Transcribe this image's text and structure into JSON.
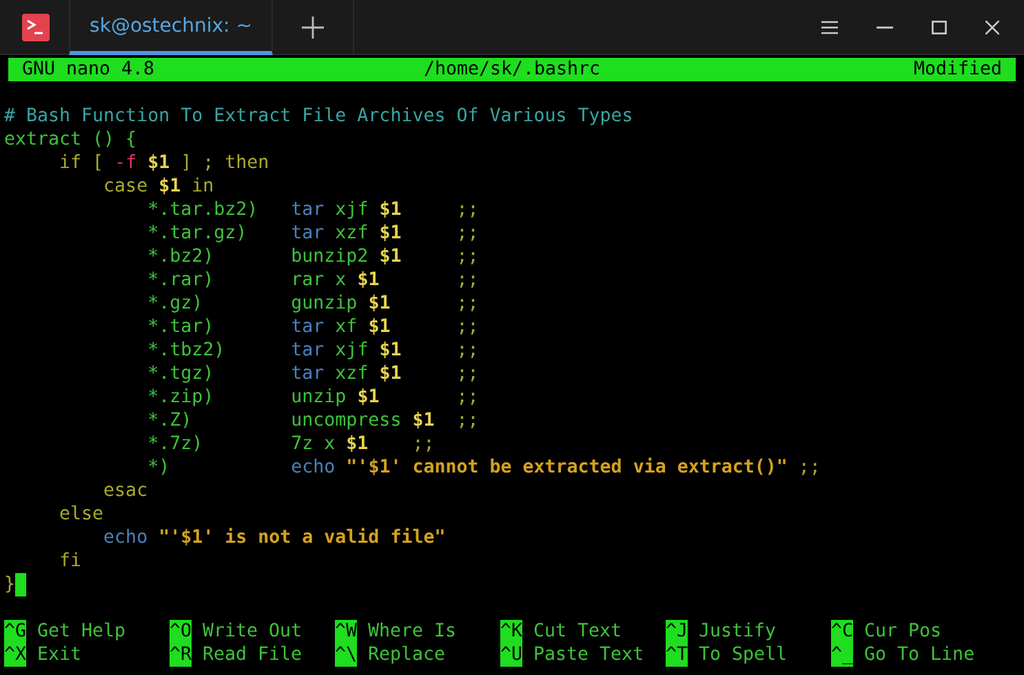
{
  "tabs": [
    {
      "label": "sk@ostechnix: ~",
      "selected": true
    }
  ],
  "header": {
    "app": "GNU nano 4.8",
    "file": "/home/sk/.bashrc",
    "status": "Modified"
  },
  "lines": [
    [
      {
        "kind": "comment",
        "text": "# Bash Function To Extract File Archives Of Various Types"
      }
    ],
    [
      {
        "kind": "name",
        "text": "extract () {"
      }
    ],
    [
      {
        "kind": "keyword",
        "text": "     if [ "
      },
      {
        "kind": "flag",
        "text": "-f"
      },
      {
        "kind": "var",
        "text": " $1"
      },
      {
        "kind": "keyword",
        "text": " ] ; then"
      }
    ],
    [
      {
        "kind": "keyword",
        "text": "         case "
      },
      {
        "kind": "var",
        "text": "$1"
      },
      {
        "kind": "keyword",
        "text": " in"
      }
    ],
    [
      {
        "kind": "name",
        "text": "             *.tar.bz2)   "
      },
      {
        "kind": "builtin",
        "text": "tar"
      },
      {
        "kind": "name",
        "text": " xjf "
      },
      {
        "kind": "var",
        "text": "$1"
      },
      {
        "kind": "keyword",
        "text": "     ;;"
      }
    ],
    [
      {
        "kind": "name",
        "text": "             *.tar.gz)    "
      },
      {
        "kind": "builtin",
        "text": "tar"
      },
      {
        "kind": "name",
        "text": " xzf "
      },
      {
        "kind": "var",
        "text": "$1"
      },
      {
        "kind": "keyword",
        "text": "     ;;"
      }
    ],
    [
      {
        "kind": "name",
        "text": "             *.bz2)       bunzip2 "
      },
      {
        "kind": "var",
        "text": "$1"
      },
      {
        "kind": "keyword",
        "text": "     ;;"
      }
    ],
    [
      {
        "kind": "name",
        "text": "             *.rar)       rar x "
      },
      {
        "kind": "var",
        "text": "$1"
      },
      {
        "kind": "keyword",
        "text": "       ;;"
      }
    ],
    [
      {
        "kind": "name",
        "text": "             *.gz)        gunzip "
      },
      {
        "kind": "var",
        "text": "$1"
      },
      {
        "kind": "keyword",
        "text": "      ;;"
      }
    ],
    [
      {
        "kind": "name",
        "text": "             *.tar)       "
      },
      {
        "kind": "builtin",
        "text": "tar"
      },
      {
        "kind": "name",
        "text": " xf "
      },
      {
        "kind": "var",
        "text": "$1"
      },
      {
        "kind": "keyword",
        "text": "      ;;"
      }
    ],
    [
      {
        "kind": "name",
        "text": "             *.tbz2)      "
      },
      {
        "kind": "builtin",
        "text": "tar"
      },
      {
        "kind": "name",
        "text": " xjf "
      },
      {
        "kind": "var",
        "text": "$1"
      },
      {
        "kind": "keyword",
        "text": "     ;;"
      }
    ],
    [
      {
        "kind": "name",
        "text": "             *.tgz)       "
      },
      {
        "kind": "builtin",
        "text": "tar"
      },
      {
        "kind": "name",
        "text": " xzf "
      },
      {
        "kind": "var",
        "text": "$1"
      },
      {
        "kind": "keyword",
        "text": "     ;;"
      }
    ],
    [
      {
        "kind": "name",
        "text": "             *.zip)       unzip "
      },
      {
        "kind": "var",
        "text": "$1"
      },
      {
        "kind": "keyword",
        "text": "       ;;"
      }
    ],
    [
      {
        "kind": "name",
        "text": "             *.Z)         uncompress "
      },
      {
        "kind": "var",
        "text": "$1"
      },
      {
        "kind": "keyword",
        "text": "  ;;"
      }
    ],
    [
      {
        "kind": "name",
        "text": "             *.7z)        7z x "
      },
      {
        "kind": "var",
        "text": "$1"
      },
      {
        "kind": "keyword",
        "text": "    ;;"
      }
    ],
    [
      {
        "kind": "name",
        "text": "             *)           "
      },
      {
        "kind": "builtin",
        "text": "echo"
      },
      {
        "kind": "string",
        "text": " \"'$1' cannot be extracted via extract()\""
      },
      {
        "kind": "keyword",
        "text": " ;;"
      }
    ],
    [
      {
        "kind": "keyword",
        "text": "         esac"
      }
    ],
    [
      {
        "kind": "keyword",
        "text": "     else"
      }
    ],
    [
      {
        "kind": "builtin",
        "text": "         echo"
      },
      {
        "kind": "string",
        "text": " \"'$1' is not a valid file\""
      }
    ],
    [
      {
        "kind": "keyword",
        "text": "     fi"
      }
    ],
    [
      {
        "kind": "keyword",
        "text": "}"
      }
    ]
  ],
  "shortcuts": [
    {
      "key": "^G",
      "label": "Get Help"
    },
    {
      "key": "^O",
      "label": "Write Out"
    },
    {
      "key": "^W",
      "label": "Where Is"
    },
    {
      "key": "^K",
      "label": "Cut Text"
    },
    {
      "key": "^J",
      "label": "Justify"
    },
    {
      "key": "^C",
      "label": "Cur Pos"
    },
    {
      "key": "^X",
      "label": "Exit"
    },
    {
      "key": "^R",
      "label": "Read File"
    },
    {
      "key": "^\\",
      "label": "Replace"
    },
    {
      "key": "^U",
      "label": "Paste Text"
    },
    {
      "key": "^T",
      "label": "To Spell"
    },
    {
      "key": "^_",
      "label": "Go To Line"
    }
  ]
}
